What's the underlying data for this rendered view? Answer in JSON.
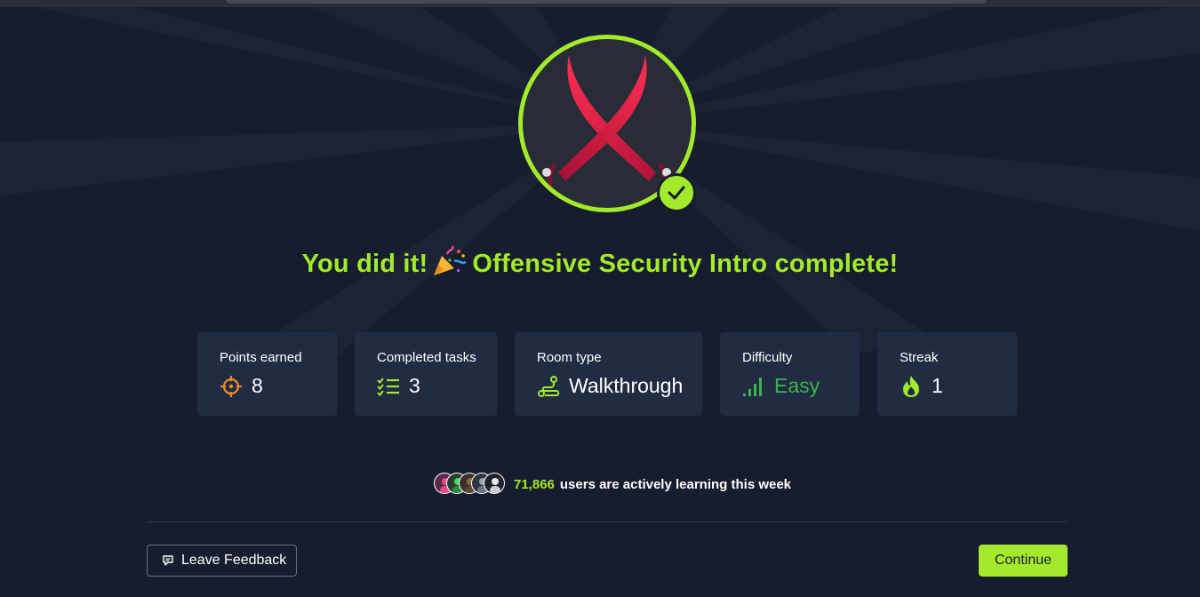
{
  "headline": {
    "prefix": "You did it!",
    "suffix": "Offensive Security Intro complete!"
  },
  "badge": {
    "icon": "crossed-swords-icon",
    "status_icon": "checkmark-icon",
    "ring_color": "#a3ea2a"
  },
  "stats": [
    {
      "label": "Points earned",
      "icon": "crosshair-icon",
      "value": "8"
    },
    {
      "label": "Completed tasks",
      "icon": "checklist-icon",
      "value": "3"
    },
    {
      "label": "Room type",
      "icon": "route-icon",
      "value": "Walkthrough"
    },
    {
      "label": "Difficulty",
      "icon": "signal-bars-icon",
      "value": "Easy"
    },
    {
      "label": "Streak",
      "icon": "flame-icon",
      "value": "1"
    }
  ],
  "learners": {
    "count": "71,866",
    "text": "users are actively learning this week"
  },
  "buttons": {
    "feedback_label": "Leave Feedback",
    "continue_label": "Continue"
  },
  "colors": {
    "background": "#161d2e",
    "accent": "#a3ea2a",
    "card": "#212c42",
    "easy": "#3bb44a",
    "icon_orange": "#f28b1e"
  }
}
